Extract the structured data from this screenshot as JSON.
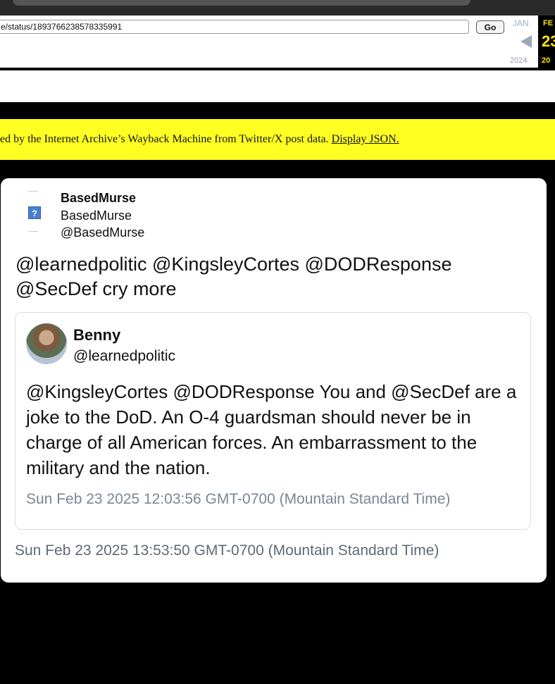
{
  "toolbar": {
    "url": "e/status/1893766238578335991",
    "go_label": "Go",
    "prev_month": "JAN",
    "prev_year": "2024",
    "current_month": "FE",
    "current_day": "23",
    "current_year": "20"
  },
  "notice": {
    "text": "ed by the Internet Archive’s Wayback Machine from Twitter/X post data.",
    "link": "Display JSON."
  },
  "tweet": {
    "display_name": "BasedMurse",
    "alt_name": "BasedMurse",
    "handle": "@BasedMurse",
    "avatar_placeholder": "?",
    "text": "@learnedpolitic @KingsleyCortes @DODResponse @SecDef cry more",
    "timestamp": "Sun Feb 23 2025 13:53:50 GMT-0700 (Mountain Standard Time)"
  },
  "quoted": {
    "display_name": "Benny",
    "handle": "@learnedpolitic",
    "text": "@KingsleyCortes @DODResponse You and @SecDef are a joke to the DoD. An O-4 guardsman should never be in charge of all American forces. An embarrassment to the military and the nation.",
    "timestamp": "Sun Feb 23 2025 12:03:56 GMT-0700 (Mountain Standard Time)"
  }
}
